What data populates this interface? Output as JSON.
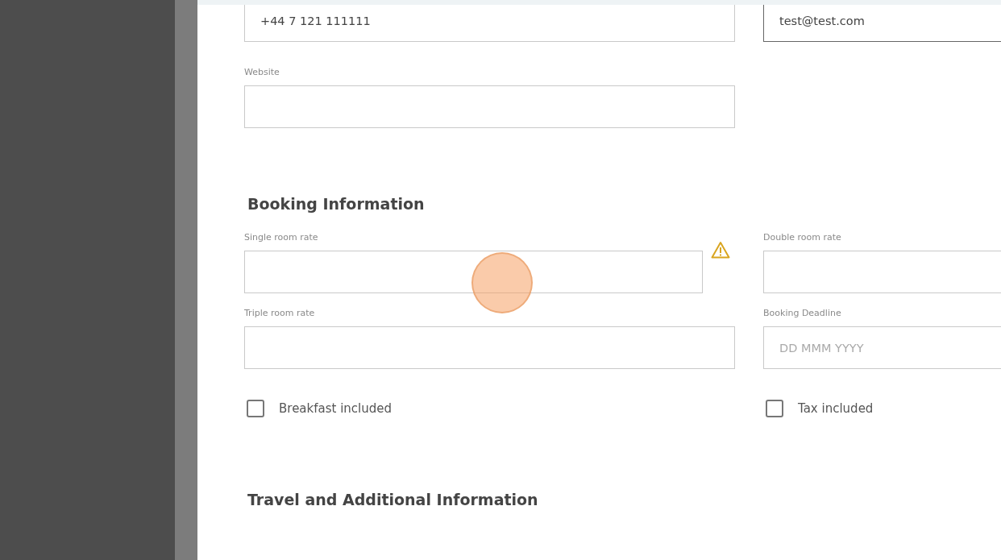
{
  "top_fields": [
    {
      "value": "+44 7 121 111111",
      "focused": false
    },
    {
      "value": "test@test.com",
      "focused": true
    }
  ],
  "website": {
    "label": "Website"
  },
  "sections": [
    {
      "title": "Booking Information",
      "fields": [
        {
          "label": "Single room rate",
          "warning": true
        },
        {
          "label": "Double room rate"
        },
        {
          "label": "Triple room rate"
        },
        {
          "label": "Booking Deadline",
          "placeholder": "DD MMM YYYY"
        }
      ],
      "checkboxes": [
        {
          "label": "Breakfast included",
          "checked": false
        },
        {
          "label": "Tax included",
          "checked": false
        }
      ]
    },
    {
      "title": "Travel and Additional Information"
    }
  ]
}
